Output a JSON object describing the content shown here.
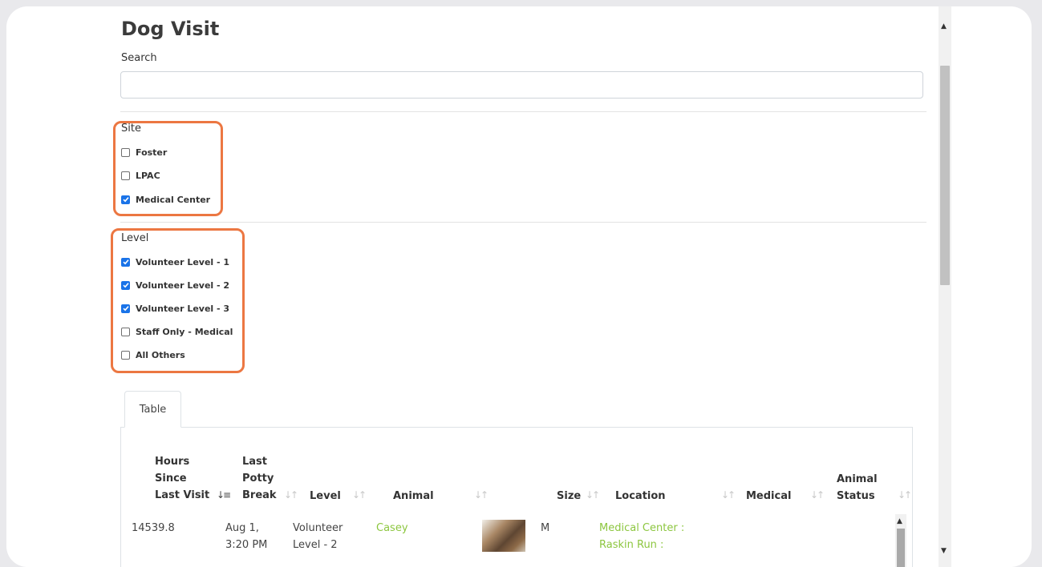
{
  "page": {
    "title": "Dog Visit"
  },
  "search": {
    "label": "Search",
    "value": "",
    "placeholder": ""
  },
  "site": {
    "label": "Site",
    "options": [
      {
        "label": "Foster",
        "checked": false
      },
      {
        "label": "LPAC",
        "checked": false
      },
      {
        "label": "Medical Center",
        "checked": true
      }
    ]
  },
  "level": {
    "label": "Level",
    "options": [
      {
        "label": "Volunteer Level - 1",
        "checked": true
      },
      {
        "label": "Volunteer Level - 2",
        "checked": true
      },
      {
        "label": "Volunteer Level - 3",
        "checked": true
      },
      {
        "label": "Staff Only - Medical",
        "checked": false
      },
      {
        "label": "All Others",
        "checked": false
      }
    ]
  },
  "tabs": [
    {
      "label": "Table",
      "active": true
    }
  ],
  "table": {
    "headers": [
      {
        "key": "hours",
        "lines": [
          "Hours",
          "Since",
          "Last Visit"
        ],
        "sort": "desc"
      },
      {
        "key": "potty",
        "lines": [
          "Last",
          "Potty",
          "Break"
        ],
        "sort": "none"
      },
      {
        "key": "level",
        "lines": [
          "Level"
        ],
        "sort": "none"
      },
      {
        "key": "animal",
        "lines": [
          "Animal"
        ],
        "sort": "none"
      },
      {
        "key": "size",
        "lines": [
          "Size"
        ],
        "sort": "none"
      },
      {
        "key": "location",
        "lines": [
          "Location"
        ],
        "sort": "none"
      },
      {
        "key": "medical",
        "lines": [
          "Medical"
        ],
        "sort": "none"
      },
      {
        "key": "status",
        "lines": [
          "Animal",
          "Status"
        ],
        "sort": "none"
      }
    ],
    "rows": [
      {
        "hours": "14539.8",
        "potty": [
          "Aug 1,",
          "3:20 PM"
        ],
        "level": [
          "Volunteer",
          "Level - 2"
        ],
        "animal": "Casey",
        "size": "M",
        "location": [
          "Medical Center :",
          "Raskin Run :"
        ]
      }
    ]
  },
  "icons": {
    "check": "check-icon",
    "sort": "sort-icon",
    "sort_active": "sort-desc-icon",
    "scroll_up": "scroll-up-arrow-icon",
    "scroll_down": "scroll-down-arrow-icon"
  },
  "colors": {
    "highlight": "#ec7742",
    "link": "#8cc63f",
    "checkbox": "#1a73e8"
  }
}
